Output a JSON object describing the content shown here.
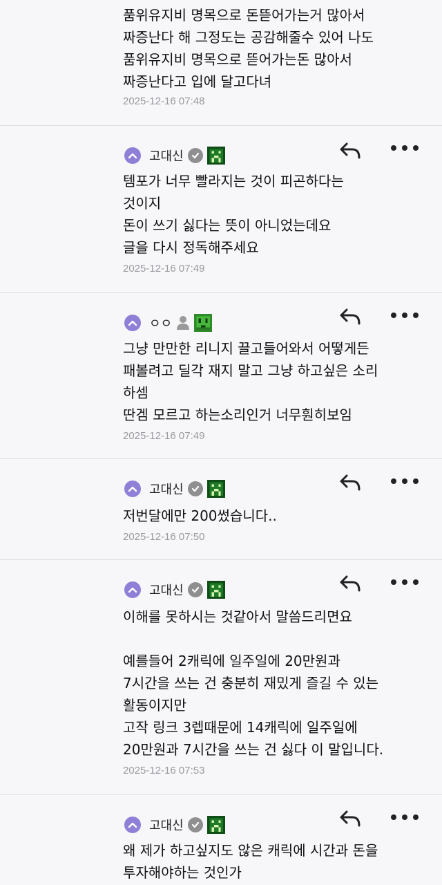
{
  "comments": [
    {
      "lines": [
        "품위유지비 명목으로 돈뜯어가는거 많아서",
        "짜증난다 해 그정도는 공감해줄수 있어 나도",
        "품위유지비 명목으로 뜯어가는돈 많아서",
        "짜증난다고 입에 달고다녀"
      ],
      "time": "2025-12-16 07:48"
    },
    {
      "name": "고대신",
      "badge": "check-badge-icon",
      "lines": [
        "템포가 너무 빨라지는 것이 피곤하다는",
        "것이지",
        "돈이 쓰기 싫다는 뜻이 아니었는데요",
        "글을 다시 정독해주세요"
      ],
      "time": "2025-12-16 07:49"
    },
    {
      "name": "ㅇㅇ",
      "badge": "person-icon",
      "lines": [
        "그냥 만만한 리니지 끌고들어와서 어떻게든",
        "패볼려고 딜각 재지 말고 그냥 하고싶은 소리",
        "하셈",
        "딴겜 모르고 하는소리인거 너무훤히보임"
      ],
      "time": "2025-12-16 07:49"
    },
    {
      "name": "고대신",
      "badge": "check-badge-icon",
      "lines": [
        "저번달에만 200썼습니다.."
      ],
      "time": "2025-12-16 07:50"
    },
    {
      "name": "고대신",
      "badge": "check-badge-icon",
      "lines": [
        "이해를 못하시는 것같아서 말씀드리면요",
        "",
        "예를들어 2캐릭에 일주일에 20만원과",
        "7시간을 쓰는 건 충분히 재밌게 즐길 수 있는",
        "활동이지만",
        "고작 링크 3렙때문에 14캐릭에 일주일에",
        "20만원과 7시간을 쓰는 건 싫다 이 말입니다."
      ],
      "time": "2025-12-16 07:53"
    },
    {
      "name": "고대신",
      "badge": "check-badge-icon",
      "lines": [
        "왜 제가 하고싶지도 않은 캐릭에 시간과 돈을",
        "투자해야하는 것인가"
      ],
      "time": ""
    }
  ],
  "colors": {
    "background": "#f7f7fa",
    "level_badge": "#8f7fd6",
    "timestamp": "#9a9a9f",
    "divider": "#dedee3"
  }
}
